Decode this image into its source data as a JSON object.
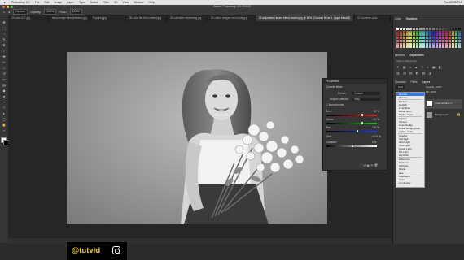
{
  "menubar": {
    "app": "Photoshop CC",
    "items": [
      "File",
      "Edit",
      "Image",
      "Layer",
      "Type",
      "Select",
      "Filter",
      "3D",
      "View",
      "Window",
      "Help"
    ],
    "right": "Thu 12:05 PM"
  },
  "window": {
    "title": "Adobe Photoshop CC 2015.5"
  },
  "options_bar": {
    "mode": "Normal",
    "opacity_label": "Opacity:",
    "opacity": "100%",
    "flow_label": "Flow:",
    "flow": "100%"
  },
  "tabs": [
    {
      "label": "20 color-017.jpg"
    },
    {
      "label": "stock image blue selection.jpg"
    },
    {
      "label": "Pop-img.jpg"
    },
    {
      "label": "06 color flat bird content.jpg"
    },
    {
      "label": "05 collective shortening.jpg"
    },
    {
      "label": "04 cotton images non-mode.jpg"
    },
    {
      "label": "03 adjustment layers blend-modes.jpg @ 50% (Channel Mixer 1, Layer Mask/8)",
      "active": true
    },
    {
      "label": "02 contents-color"
    }
  ],
  "properties": {
    "title": "Properties",
    "layer_name": "Channel Mixer",
    "preset_label": "Preset:",
    "preset": "Custom",
    "output_label": "Output Channel:",
    "output": "Gray",
    "monochrome": "Monochrome",
    "red_label": "Red:",
    "red": "+40 %",
    "red_pct": 0.7,
    "green_label": "Green:",
    "green": "+40 %",
    "green_pct": 0.7,
    "blue_label": "Blue:",
    "blue": "+20 %",
    "blue_pct": 0.6,
    "total_label": "Total:",
    "total": "+100 %",
    "constant_label": "Constant:",
    "constant": "0 %",
    "constant_pct": 0.5
  },
  "right_panel": {
    "top_tabs": [
      "Color",
      "Swatches"
    ],
    "mid_tabs": [
      "Libraries",
      "Adjustments"
    ],
    "add_adjustment": "Add an adjustment",
    "layer_tabs": [
      "Channels",
      "Paths",
      "Layers"
    ],
    "kind": "Kind",
    "opacity_label": "Opacity:",
    "opacity": "100%",
    "fill_label": "Fill:",
    "fill": "100%",
    "layers": [
      "Channel Mixer 1",
      "Background"
    ]
  },
  "blend_modes": {
    "groups": [
      [
        "Normal",
        "Dissolve"
      ],
      [
        "Darken",
        "Multiply",
        "Color Burn",
        "Linear Burn",
        "Darker Color"
      ],
      [
        "Lighten",
        "Screen",
        "Color Dodge",
        "Linear Dodge (Add)",
        "Lighter Color"
      ],
      [
        "Overlay",
        "Soft Light",
        "Hard Light",
        "Vivid Light",
        "Linear Light",
        "Pin Light",
        "Hard Mix"
      ],
      [
        "Difference",
        "Exclusion",
        "Subtract",
        "Divide"
      ],
      [
        "Hue",
        "Saturation",
        "Color",
        "Luminosity"
      ]
    ],
    "selected": "Normal"
  },
  "brand": {
    "handle": "@tutvid",
    "accent": "#f4d21e"
  },
  "colors": {
    "ui_bg": "#2b2b2b",
    "panel": "#353535",
    "selection": "#3b78d8"
  }
}
